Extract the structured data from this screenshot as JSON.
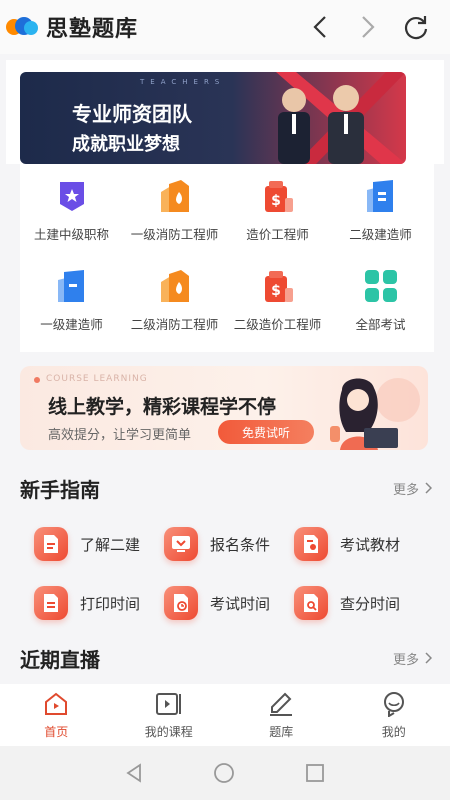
{
  "app": {
    "name": "思塾题库"
  },
  "banner": {
    "overline": "TEACHERS",
    "line1": "专业师资团队",
    "line2": "成就职业梦想"
  },
  "categories": [
    {
      "label": "土建中级职称",
      "icon": "badge-star-icon",
      "color": "#6a4ee6"
    },
    {
      "label": "一级消防工程师",
      "icon": "fire-building-icon",
      "color": "#f58a1f"
    },
    {
      "label": "造价工程师",
      "icon": "dollar-bag-icon",
      "color": "#ee4a32"
    },
    {
      "label": "二级建造师",
      "icon": "building-icon",
      "color": "#2f80ed"
    },
    {
      "label": "一级建造师",
      "icon": "building-icon",
      "color": "#2f80ed"
    },
    {
      "label": "二级消防工程师",
      "icon": "fire-building-icon",
      "color": "#f58a1f"
    },
    {
      "label": "二级造价工程师",
      "icon": "dollar-bag-icon",
      "color": "#ee4a32"
    },
    {
      "label": "全部考试",
      "icon": "grid-icon",
      "color": "#2cc4a6"
    }
  ],
  "promo": {
    "overline": "COURSE LEARNING",
    "title": "线上教学，精彩课程学不停",
    "tagline": "高效提分，让学习更简单",
    "cta": "免费试听"
  },
  "guide": {
    "title": "新手指南",
    "more": "更多",
    "items": [
      {
        "label": "了解二建",
        "icon": "document-icon"
      },
      {
        "label": "报名条件",
        "icon": "monitor-icon"
      },
      {
        "label": "考试教材",
        "icon": "book-icon"
      },
      {
        "label": "打印时间",
        "icon": "printer-icon"
      },
      {
        "label": "考试时间",
        "icon": "clock-doc-icon"
      },
      {
        "label": "查分时间",
        "icon": "search-doc-icon"
      }
    ]
  },
  "live": {
    "title": "近期直播",
    "more": "更多"
  },
  "bottom_nav": [
    {
      "label": "首页",
      "icon": "home-icon",
      "active": true
    },
    {
      "label": "我的课程",
      "icon": "video-icon",
      "active": false
    },
    {
      "label": "题库",
      "icon": "edit-icon",
      "active": false
    },
    {
      "label": "我的",
      "icon": "profile-icon",
      "active": false
    }
  ],
  "colors": {
    "accent": "#e04a2e",
    "orange": "#f58a1f",
    "blue": "#2f80ed"
  }
}
